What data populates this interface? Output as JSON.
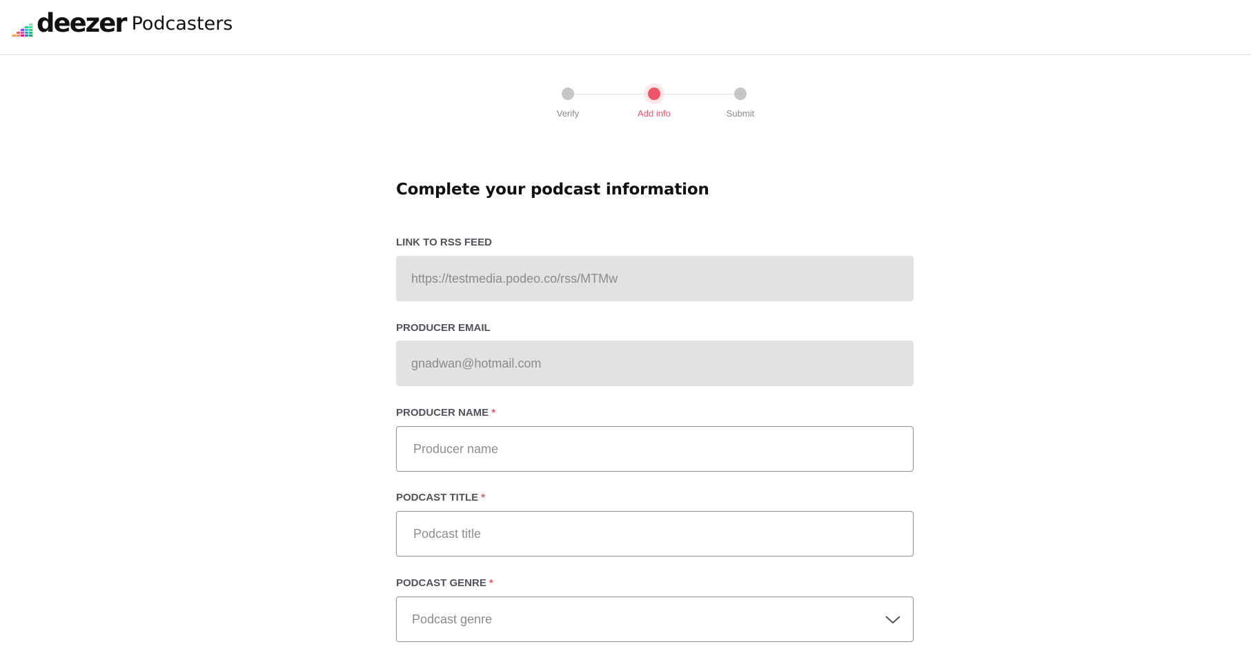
{
  "brand": {
    "name": "deezer",
    "product": "Podcasters",
    "bar_colors": [
      "#ff0000",
      "#ffed00",
      "#ff0092",
      "#c2ff00",
      "#00c7f2",
      "#c1f1fc",
      "#ebffac",
      "#ffc3e5",
      "#ff8b8b",
      "#feaa2d"
    ]
  },
  "stepper": {
    "steps": [
      {
        "label": "Verify",
        "state": "done"
      },
      {
        "label": "Add info",
        "state": "active"
      },
      {
        "label": "Submit",
        "state": "pending"
      }
    ],
    "accent_color": "#ef5466"
  },
  "form": {
    "title": "Complete your podcast information",
    "fields": [
      {
        "label": "LINK TO RSS FEED",
        "required": false,
        "value": "https://testmedia.podeo.co/rss/MTMw",
        "readonly": true
      },
      {
        "label": "PRODUCER EMAIL",
        "required": false,
        "value": "gnadwan@hotmail.com",
        "readonly": true
      },
      {
        "label": "PRODUCER NAME",
        "required": true,
        "placeholder": "Producer name",
        "value": ""
      },
      {
        "label": "PODCAST TITLE",
        "required": true,
        "placeholder": "Podcast title",
        "value": ""
      },
      {
        "label": "PODCAST GENRE",
        "required": true,
        "placeholder": "Podcast genre",
        "type": "select",
        "icon": "chevron-down-icon"
      }
    ],
    "required_marker": "*"
  }
}
